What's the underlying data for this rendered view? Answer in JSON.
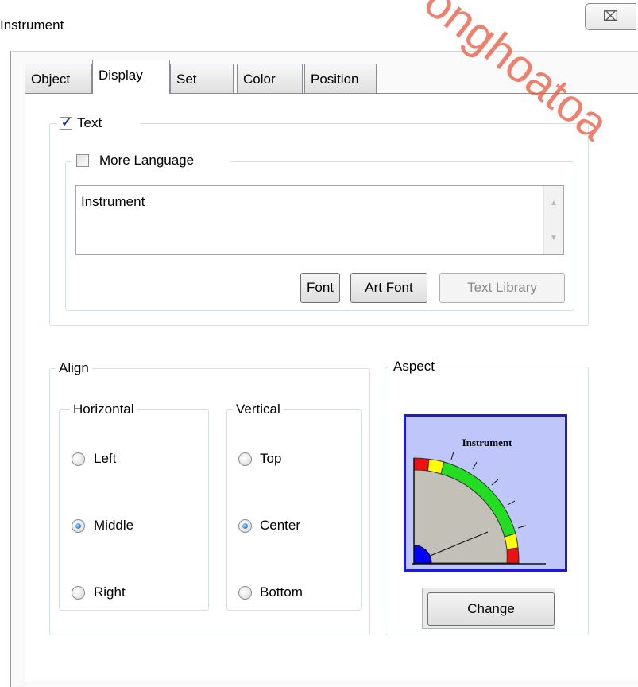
{
  "window": {
    "title": "Instrument",
    "close_glyph": "⌧"
  },
  "tabs": [
    {
      "label": "Object",
      "active": false
    },
    {
      "label": "Display",
      "active": true
    },
    {
      "label": "Set",
      "active": false
    },
    {
      "label": "Color",
      "active": false
    },
    {
      "label": "Position",
      "active": false
    }
  ],
  "text_group": {
    "checkbox_label": "Text",
    "checked": true,
    "more_language_label": "More Language",
    "more_language_checked": false,
    "text_value": "Instrument",
    "buttons": {
      "font": "Font",
      "art_font": "Art Font",
      "text_library": "Text Library"
    }
  },
  "align": {
    "legend": "Align",
    "horizontal": {
      "legend": "Horizontal",
      "options": [
        "Left",
        "Middle",
        "Right"
      ],
      "selected": "Middle"
    },
    "vertical": {
      "legend": "Vertical",
      "options": [
        "Top",
        "Center",
        "Bottom"
      ],
      "selected": "Center"
    }
  },
  "aspect": {
    "legend": "Aspect",
    "preview_title": "Instrument",
    "change_label": "Change",
    "colors": {
      "frame": "#1e1ad6",
      "background": "#bfc6fa",
      "dial": "#c3c0b8",
      "green": "#22dd22",
      "yellow": "#ffff00",
      "red": "#ee1111",
      "hub": "#0000ff"
    }
  },
  "watermark": {
    "text": "onghoatoa"
  }
}
